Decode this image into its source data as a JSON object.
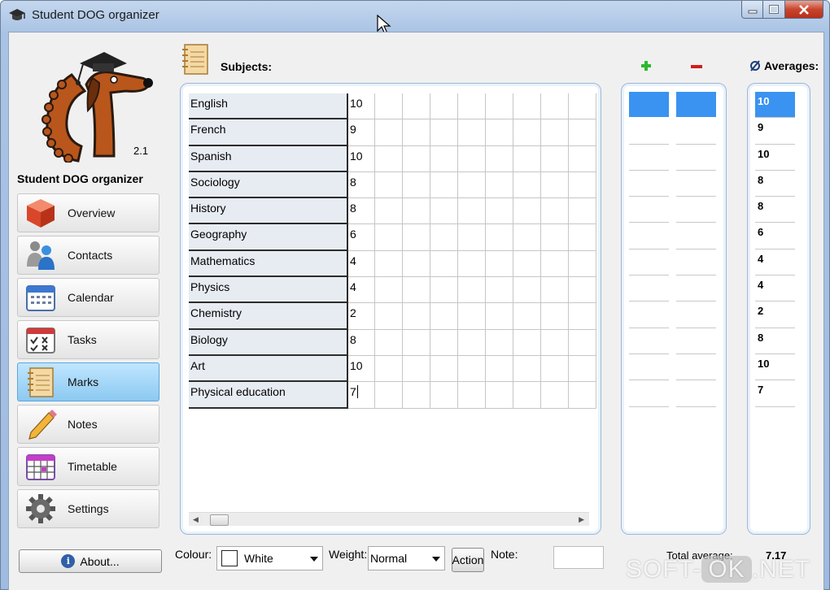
{
  "window": {
    "title": "Student DOG organizer",
    "controls": {
      "minimize": "minimize",
      "maximize": "maximize",
      "close": "close"
    }
  },
  "sidebar": {
    "version": "2.1",
    "app_name": "Student DOG organizer",
    "items": [
      {
        "label": "Overview",
        "icon": "cube-icon"
      },
      {
        "label": "Contacts",
        "icon": "people-icon"
      },
      {
        "label": "Calendar",
        "icon": "calendar-icon"
      },
      {
        "label": "Tasks",
        "icon": "tasks-icon"
      },
      {
        "label": "Marks",
        "icon": "notebook-icon",
        "active": true
      },
      {
        "label": "Notes",
        "icon": "pencil-icon"
      },
      {
        "label": "Timetable",
        "icon": "timetable-icon"
      },
      {
        "label": "Settings",
        "icon": "gear-icon"
      }
    ],
    "about_label": "About..."
  },
  "subjects": {
    "header": "Subjects:",
    "rows": [
      {
        "name": "English",
        "mark": "10"
      },
      {
        "name": "French",
        "mark": "9"
      },
      {
        "name": "Spanish",
        "mark": "10"
      },
      {
        "name": "Sociology",
        "mark": "8"
      },
      {
        "name": "History",
        "mark": "8"
      },
      {
        "name": "Geography",
        "mark": "6"
      },
      {
        "name": "Mathematics",
        "mark": "4"
      },
      {
        "name": "Physics",
        "mark": "4"
      },
      {
        "name": "Chemistry",
        "mark": "2"
      },
      {
        "name": "Biology",
        "mark": "8"
      },
      {
        "name": "Art",
        "mark": "10"
      },
      {
        "name": "Physical education",
        "mark": "7"
      }
    ]
  },
  "averages": {
    "header": "Averages:",
    "values": [
      "10",
      "9",
      "10",
      "8",
      "8",
      "6",
      "4",
      "4",
      "2",
      "8",
      "10",
      "7"
    ]
  },
  "toolbar": {
    "colour_label": "Colour:",
    "colour_value": "White",
    "weight_label": "Weight:",
    "weight_value": "Normal",
    "action_label": "Action",
    "note_label": "Note:",
    "total_label": "Total average:",
    "total_value": "7.17"
  },
  "watermark": {
    "left": "SOFT-",
    "ok": "OK",
    "right": ".NET"
  },
  "colors": {
    "selection": "#3a93f0",
    "active_nav": "#8cc9f1",
    "plus": "#2db82d",
    "minus": "#d31b1b"
  }
}
